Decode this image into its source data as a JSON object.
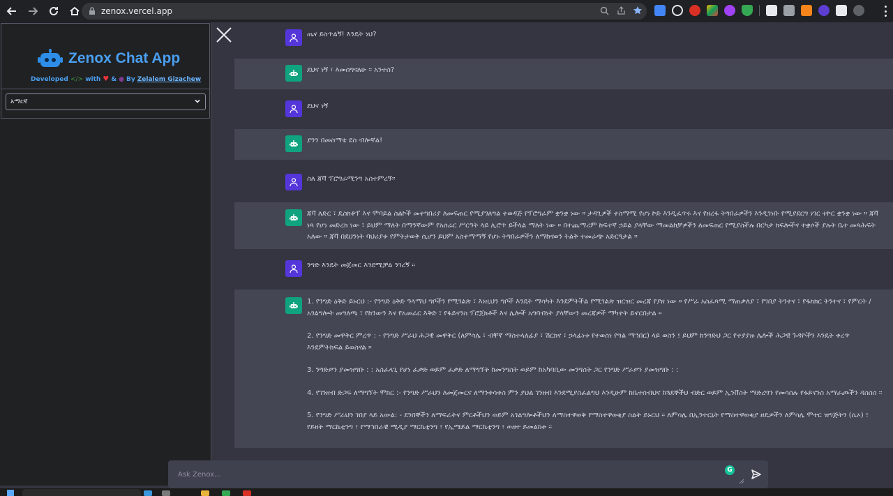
{
  "browser": {
    "url": "zenox.vercel.app"
  },
  "sidebar": {
    "app_title": "Zenox Chat App",
    "credit_developed": "Developed",
    "credit_with": "with",
    "credit_and": "&",
    "credit_by": "By",
    "credit_author": "Zelalem Gizachew",
    "language_selected": "አማርኛ"
  },
  "messages": [
    {
      "role": "user",
      "text": "ጤና ይስጥልኝ! እንዴት ነህ?"
    },
    {
      "role": "bot",
      "text": "ደህና ነኝ ፣ እመሰግናለሁ ። አንተስ?"
    },
    {
      "role": "user",
      "text": "ደህና ነኝ"
    },
    {
      "role": "bot",
      "text": "ያንን በመስማቴ ደስ ብሎኛል!"
    },
    {
      "role": "user",
      "text": "ስለ ጃቫ ፕሮግራሚንግ አስተምረኝ።"
    },
    {
      "role": "bot",
      "text": "ጃቫ ለድር ፣ ዴስክቶፕ እና ሞባይል ስልኮች መተግበሪያ ለመፍጠር የሚያገለግል ተወዳጅ የፕሮግራም ቋንቋ ነው ። ታዳጊዎች ተስማሚ የሆነ ኮድ እንዲፈጥሩ እና የዘረፋ ትግበራዎችን እንዲገነቡ የሚያደርግ ነገር ተኮር ቋንቋ ነው ። ጃቫ ነጻ የሆነ መድረክ ነው ፣ ይህም ማለት በማንኛውም የአሰራር ሥርዓት ላይ ሊሮጥ ይችላል ማለት ነው ። በተጨማሪም ከፍተኛ ኃይል ያላቸው ማመልከቻዎችን ለመፍጠር የሚያስችሉ በርካታ ክፍሎችና ተቋሶች ያሉት ቤተ መጻሕፍት አለው ። ጃቫ በደህንነት ባህሪያቱ የምትታወቅ ሲሆን ይህም አስተማማኝ የሆኑ ትግበራዎችን ለማከናወን ትልቅ ተመራጭ አድርጓታል ።"
    },
    {
      "role": "user",
      "text": "ንግድ እንዴት መጀመር እንደሚቻል ንገረኝ ።"
    },
    {
      "role": "bot",
      "paragraphs": [
        "1. የንግድ ዕቅድ ይኑርህ :- የንግድ ዕቅድ ዓላማህ ግቦችን የሚገልጽ ፣ እነዚህን ግቦች እንዴት ማሳካት እንደምትችል የሚገልጽ ዝርዝር መረጃ የያዘ ነው ። የሥራ አስፈጻሚ ማጠቃለያ ፣ የገበያ ትንተና ፣ የፋክክር ትንተና ፣ የምርት / አገልግሎት መግለጫ ፣ የከንውን እና የአመራር እቅድ ፣ የፋይናንስ ፕሮጀክቶች እና ሌሎች አግባብነት ያላቸውን መረጃዎች ማካተት ይኖርበታል ።",
        "2. የንግድ መዋቅር ምረጥ : - የንግድ ሥራህ ሕጋዊ መዋቅር (ለምሳሌ ፣ ብቸኛ ማስተላለፊያ ፣ ሽርክና ፣ ኃላፊነቱ የተወሰነ የግል ማኅበር) ላይ ወስን ፤ ይህም ከንግድህ ጋር የተያያዙ ሌሎች ሕጋዊ ጉዳዮችን እንዴት ቀረጥ እንደምትከፍል ይወስናል ።",
        "3. ንግድዎን ያመዝግቡ : : አስፈላጊ የሆነ ፈቃድ ወይም ፈቃድ ለማግኘት ከመንግስት ወይም ከአካባቢው መንግስት ጋር የንግድ ሥራዎን ያመዝግቡ : :",
        "4. የገንዘብ ድጋፍ ለማግኘት ሞክር :- የንግድ ሥራህን ለመጀመርና ለማንቀሳቀስ ምን ያህል ገንዘብ እንደሚያስፈልግህ እንዲሁም ከቤተሰብህና ከጓደኞችህ ብድር ወይም ኢንቨስት ማድረግን የመሳሰሉ የፋይናንስ አማራጮችን ዳስስስ ።",
        "5. የንግድ ሥራህን ገበያ ላይ አውል: - ደንበኞችን ለማፍራትና ምርቶችህን ወይም አገልግሎቶችህን ለማስተዋወቅ የማስተዋወቂያ ስልት ይኑርህ ። ለምሳሌ በኢንተርኔት የማስተዋወቂያ ዘዴዎችን ለምሳሌ ሞተር ዝግጅትን (ሴኦ) ፣ የይዘት ማርኬቲንግ ፣ የማኅበራዊ ሚዲያ ማርኬቲንግ ፣ የኢሜይል ማርኬቲንግ ፣ ወዘተ ይመልከቱ ።"
      ]
    }
  ],
  "input": {
    "placeholder": "Ask Zenox..."
  },
  "colors": {
    "user_avatar": "#5436da",
    "bot_avatar": "#10a37f",
    "brand": "#4a9ff0"
  }
}
